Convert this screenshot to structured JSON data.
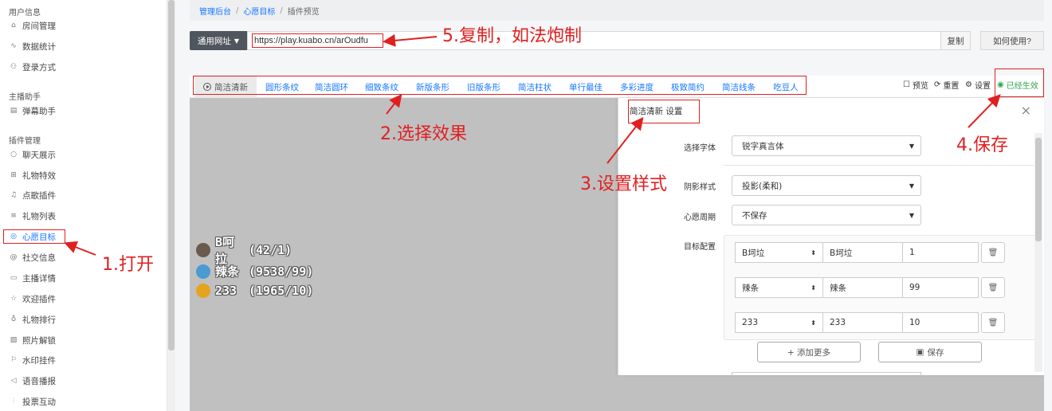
{
  "sidebar": {
    "sections": [
      {
        "title": "用户信息"
      },
      {
        "title": "主播助手"
      },
      {
        "title": "插件管理"
      }
    ],
    "items": [
      {
        "label": "房间管理",
        "icon": "home-icon"
      },
      {
        "label": "数据统计",
        "icon": "chart-line-icon"
      },
      {
        "label": "登录方式",
        "icon": "users-icon"
      },
      {
        "label": "弹幕助手",
        "icon": "window-icon"
      },
      {
        "label": "聊天展示",
        "icon": "chat-bubble-icon"
      },
      {
        "label": "礼物特效",
        "icon": "gift-icon"
      },
      {
        "label": "点歌插件",
        "icon": "music-icon"
      },
      {
        "label": "礼物列表",
        "icon": "list-icon"
      },
      {
        "label": "心愿目标",
        "icon": "target-icon",
        "active": true
      },
      {
        "label": "社交信息",
        "icon": "at-icon"
      },
      {
        "label": "主播详情",
        "icon": "card-icon"
      },
      {
        "label": "欢迎插件",
        "icon": "star-icon"
      },
      {
        "label": "礼物排行",
        "icon": "medal-icon"
      },
      {
        "label": "照片解锁",
        "icon": "image-icon"
      },
      {
        "label": "水印挂件",
        "icon": "flag-icon"
      },
      {
        "label": "语音播报",
        "icon": "speaker-icon"
      },
      {
        "label": "投票互动",
        "icon": "bar-chart-icon"
      }
    ]
  },
  "breadcrumb": {
    "home": "管理后台",
    "parent": "心愿目标",
    "current": "插件预览",
    "separator": "/"
  },
  "url_row": {
    "type_label": "通用网址",
    "url_value": "https://play.kuabo.cn/arOudfu",
    "copy_label": "复制",
    "help_label": "如何使用?"
  },
  "tabs": [
    {
      "label": "简洁清新",
      "active": true
    },
    {
      "label": "圆形条纹"
    },
    {
      "label": "简洁圆环"
    },
    {
      "label": "细致条纹"
    },
    {
      "label": "新版条形"
    },
    {
      "label": "旧版条形"
    },
    {
      "label": "简洁柱状"
    },
    {
      "label": "单行最佳"
    },
    {
      "label": "多彩进度"
    },
    {
      "label": "极致简约"
    },
    {
      "label": "简洁线条"
    },
    {
      "label": "吃豆人"
    }
  ],
  "toolbar": {
    "preview_label": "预览",
    "reset_label": "重置",
    "settings_label": "设置",
    "status_label": "已经生效",
    "status_color": "#2fa84f"
  },
  "preview_rows": [
    {
      "name": "B呵拉",
      "count": "(42/1)"
    },
    {
      "name": "辣条",
      "count": "(9538/99)"
    },
    {
      "name": "233",
      "count": "(1965/10)"
    }
  ],
  "panel": {
    "title": "简洁清新 设置",
    "font_label": "选择字体",
    "font_value": "锐字真言体",
    "shadow_label": "阴影样式",
    "shadow_value": "投影(柔和)",
    "cycle_label": "心愿周期",
    "cycle_value": "不保存",
    "targets_label": "目标配置",
    "targets": [
      {
        "gift": "B坷垃",
        "name": "B坷垃",
        "goal": "1"
      },
      {
        "gift": "辣条",
        "name": "辣条",
        "goal": "99"
      },
      {
        "gift": "233",
        "name": "233",
        "goal": "10"
      }
    ],
    "add_more_label": "+ 添加更多",
    "save_label": "保存"
  },
  "annotations": {
    "step1": "1.打开",
    "step2": "2.选择效果",
    "step3": "3.设置样式",
    "step4": "4.保存",
    "step5": "5.复制，如法炮制",
    "color": "#e02020"
  }
}
